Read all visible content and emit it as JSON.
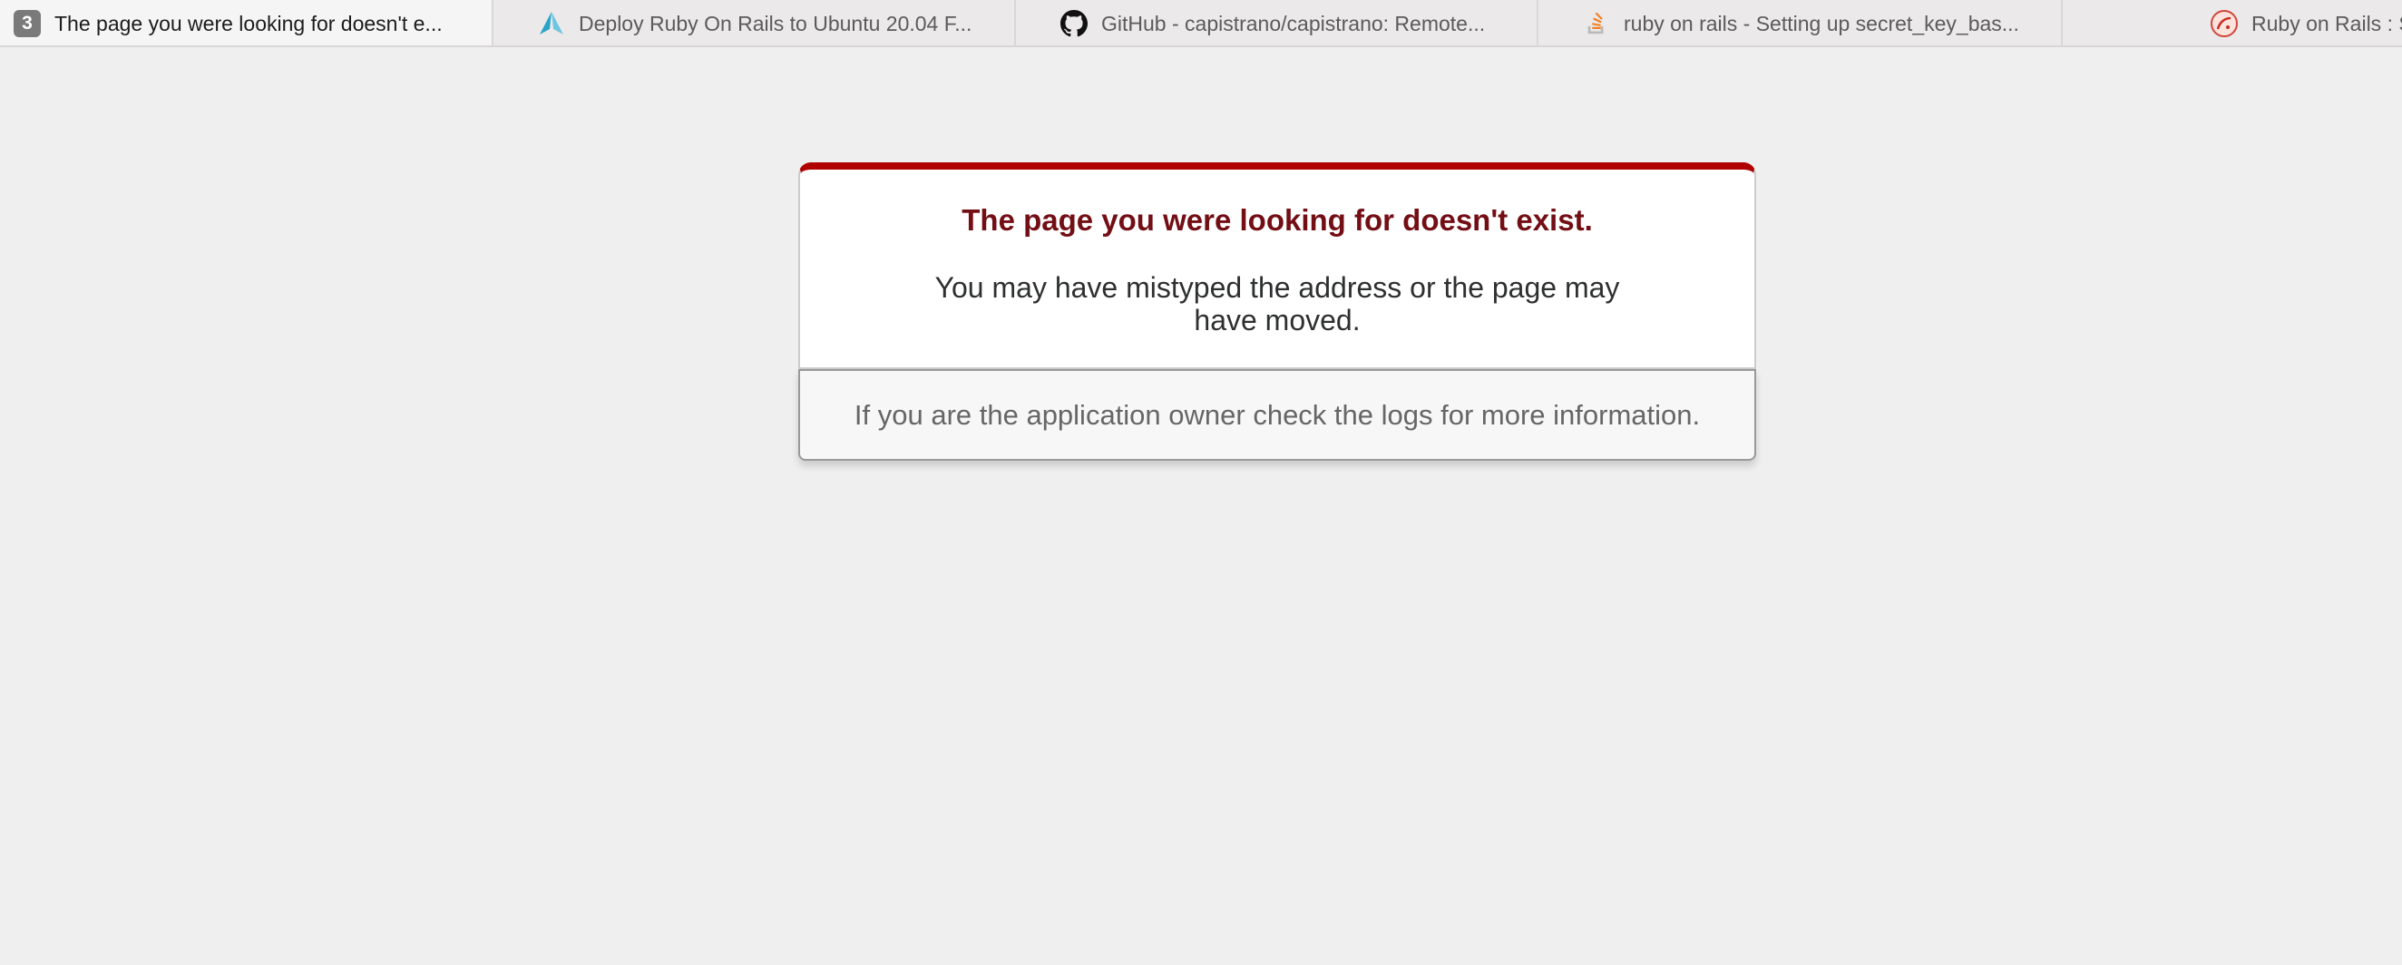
{
  "tabs": [
    {
      "title": "The page you were looking for doesn't e...",
      "badge": "3",
      "icon": "tab-count-badge-icon",
      "active": true
    },
    {
      "title": "Deploy Ruby On Rails to Ubuntu 20.04 F...",
      "icon": "gorails-icon",
      "active": false
    },
    {
      "title": "GitHub - capistrano/capistrano: Remote...",
      "icon": "github-icon",
      "active": false
    },
    {
      "title": "ruby on rails - Setting up secret_key_bas...",
      "icon": "stackoverflow-icon",
      "active": false
    },
    {
      "title": "Ruby on Rails : S",
      "icon": "rails-icon",
      "active": false
    }
  ],
  "error": {
    "heading": "The page you were looking for doesn't exist.",
    "message": "You may have mistyped the address or the page may have moved.",
    "owner_note": "If you are the application owner check the logs for more information."
  },
  "colors": {
    "accent_bar": "#b00100",
    "heading": "#730e15",
    "page_background": "#efefef"
  }
}
